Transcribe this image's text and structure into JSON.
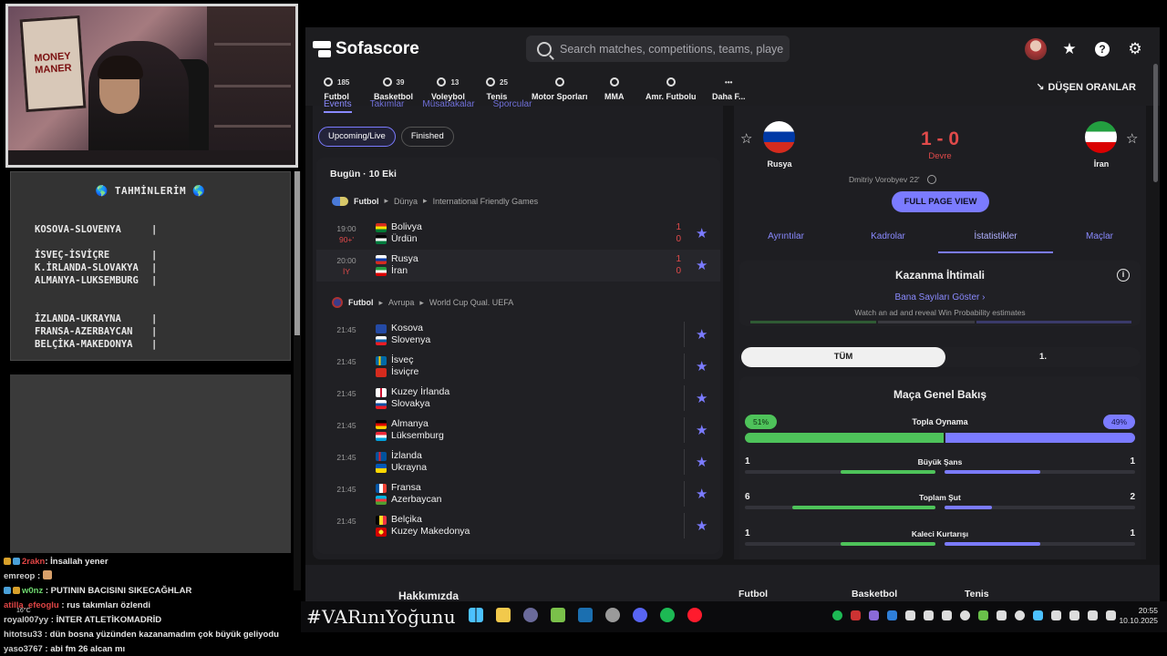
{
  "stream": {
    "predictions_title": "🌎 TAHMİNLERİM 🌎",
    "predictions_group1": [
      "KOSOVA-SLOVENYA"
    ],
    "predictions_group2": [
      "İSVEÇ-İSVİÇRE",
      "K.İRLANDA-SLOVAKYA",
      "ALMANYA-LUKSEMBURG"
    ],
    "predictions_group3": [
      "İZLANDA-UKRAYNA",
      "FRANSA-AZERBAYCAN",
      "BELÇİKA-MAKEDONYA"
    ],
    "separator": "|",
    "hashtag": "#VARınıYoğunu",
    "poster_lines": [
      "MONEY",
      "MANER"
    ]
  },
  "chat": [
    {
      "user": "2rakn",
      "msg": ": İnsallah yener",
      "color": "#e04545"
    },
    {
      "user": "emreop",
      "msg": " :",
      "color": "#cfcfcf"
    },
    {
      "user": "w0nz",
      "msg": " : PUTININ BACISINI SIKECAĞHLAR",
      "color": "#6fd86f"
    },
    {
      "user": "atilla_efeoglu",
      "msg": " : rus takımları özlendi",
      "color": "#e04545"
    },
    {
      "user": "royal007yy",
      "msg": " : İNTER ATLETİKOMADRİD",
      "color": "#cfcfcf"
    },
    {
      "user": "hitotsu33",
      "msg": " : dün bosna yüzünden kazanamadım çok büyük geliyodu",
      "color": "#cfcfcf"
    },
    {
      "user": "yaso3767",
      "msg": " : abi fm 26 alcan mı",
      "color": "#cfcfcf"
    }
  ],
  "sofascore": {
    "logo": "Sofascore",
    "search_placeholder": "Search matches, competitions, teams, playe...",
    "sports": [
      {
        "label": "Futbol",
        "count": "185"
      },
      {
        "label": "Basketbol",
        "count": "39"
      },
      {
        "label": "Voleybol",
        "count": "13"
      },
      {
        "label": "Tenis",
        "count": "25"
      },
      {
        "label": "Motor Sporları",
        "count": ""
      },
      {
        "label": "MMA",
        "count": ""
      },
      {
        "label": "Amr. Futbolu",
        "count": ""
      },
      {
        "label": "Daha F...",
        "count": ""
      }
    ],
    "dusen_oranlar": "DÜŞEN ORANLAR",
    "subtabs": [
      "Events",
      "Takımlar",
      "Müsabakalar",
      "Sporcular"
    ],
    "filters": [
      "Upcoming/Live",
      "Finished"
    ],
    "date_header": "Bugün · 10 Eki",
    "league1": {
      "sport": "Futbol",
      "region": "Dünya",
      "name": "International Friendly Games"
    },
    "league2": {
      "sport": "Futbol",
      "region": "Avrupa",
      "name": "World Cup Qual. UEFA"
    },
    "matches_friendly": [
      {
        "time": "19:00",
        "status": "90+'",
        "home": "Bolivya",
        "away": "Ürdün",
        "hs": "1",
        "as": "0"
      },
      {
        "time": "20:00",
        "status": "İY",
        "home": "Rusya",
        "away": "İran",
        "hs": "1",
        "as": "0"
      }
    ],
    "matches_wcq": [
      {
        "time": "21:45",
        "home": "Kosova",
        "away": "Slovenya"
      },
      {
        "time": "21:45",
        "home": "İsveç",
        "away": "İsviçre"
      },
      {
        "time": "21:45",
        "home": "Kuzey İrlanda",
        "away": "Slovakya"
      },
      {
        "time": "21:45",
        "home": "Almanya",
        "away": "Lüksemburg"
      },
      {
        "time": "21:45",
        "home": "İzlanda",
        "away": "Ukrayna"
      },
      {
        "time": "21:45",
        "home": "Fransa",
        "away": "Azerbaycan"
      },
      {
        "time": "21:45",
        "home": "Belçika",
        "away": "Kuzey Makedonya"
      }
    ],
    "detail": {
      "home": "Rusya",
      "away": "İran",
      "score": "1 - 0",
      "status": "Devre",
      "scorer": "Dmitriy Vorobyev 22'",
      "full_page": "FULL PAGE VIEW",
      "tabs": [
        "Ayrıntılar",
        "Kadrolar",
        "İstatistikler",
        "Maçlar"
      ],
      "win_prob_title": "Kazanma İhtimali",
      "win_prob_link": "Bana Sayıları Göster",
      "win_prob_note": "Watch an ad and reveal Win Probability estimates",
      "period_all": "TÜM",
      "period_first": "1.",
      "overview_title": "Maça Genel Bakış",
      "possession": {
        "label": "Topla Oynama",
        "home": "51%",
        "away": "49%",
        "home_frac": 0.51
      },
      "stats": [
        {
          "label": "Büyük Şans",
          "home": "1",
          "away": "1",
          "home_frac": 0.5,
          "away_frac": 0.5
        },
        {
          "label": "Toplam Şut",
          "home": "6",
          "away": "2",
          "home_frac": 0.75,
          "away_frac": 0.25
        },
        {
          "label": "Kaleci Kurtarışı",
          "home": "1",
          "away": "1",
          "home_frac": 0.5,
          "away_frac": 0.5
        }
      ]
    },
    "footer": [
      "Hakkımızda",
      "Futbol",
      "Basketbol",
      "Tenis"
    ]
  },
  "taskbar": {
    "time": "20:55",
    "date": "10.10.2025",
    "weather": "16°C"
  },
  "colors": {
    "accent": "#7b7bff",
    "home_green": "#4ec35a",
    "live_red": "#e04a4a",
    "bg": "#161618"
  }
}
